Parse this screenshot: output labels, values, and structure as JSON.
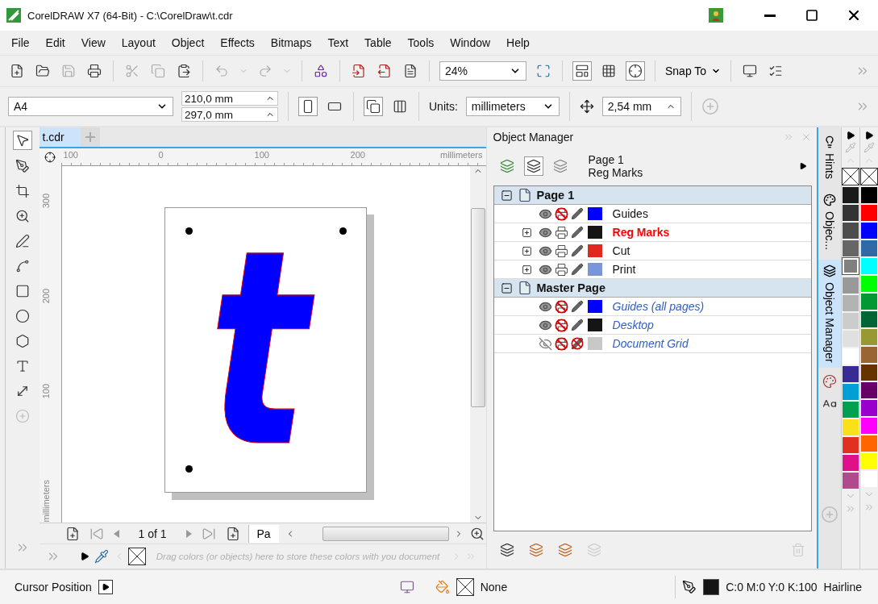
{
  "window": {
    "title": "CorelDRAW X7 (64-Bit) - C:\\CorelDraw\\t.cdr"
  },
  "menu": [
    {
      "label": "File"
    },
    {
      "label": "Edit"
    },
    {
      "label": "View"
    },
    {
      "label": "Layout"
    },
    {
      "label": "Object"
    },
    {
      "label": "Effects"
    },
    {
      "label": "Bitmaps"
    },
    {
      "label": "Text"
    },
    {
      "label": "Table"
    },
    {
      "label": "Tools"
    },
    {
      "label": "Window"
    },
    {
      "label": "Help"
    }
  ],
  "toolbar": {
    "zoom": "24%",
    "snap_to": "Snap To"
  },
  "property_bar": {
    "page_size": "A4",
    "width": "210,0 mm",
    "height": "297,0 mm",
    "units_label": "Units:",
    "units": "millimeters",
    "nudge": "2,54 mm"
  },
  "document_tabs": [
    {
      "label": "t.cdr",
      "selected": true
    }
  ],
  "rulers": {
    "horizontal_labels": [
      "100",
      "0",
      "100",
      "200"
    ],
    "horizontal_unit": "millimeters",
    "vertical_labels": [
      "300",
      "200",
      "100"
    ],
    "vertical_unit": "millimeters"
  },
  "canvas": {
    "artwork_text": "t"
  },
  "page_navigator": {
    "counter": "1 of 1",
    "page_tab": "Pa"
  },
  "color_tray": {
    "hint": "Drag colors (or objects) here to store these colors with you document"
  },
  "object_manager": {
    "title": "Object Manager",
    "breadcrumb": [
      "Page 1",
      "Reg Marks"
    ],
    "pages": [
      {
        "name": "Page 1",
        "expanded": true,
        "layers": [
          {
            "name": "Guides",
            "kind": "layer",
            "selected": false,
            "expandable": false,
            "visible": true,
            "printable": false,
            "editable": true,
            "color": "#0000ff"
          },
          {
            "name": "Reg Marks",
            "kind": "layer",
            "selected": true,
            "expandable": true,
            "visible": true,
            "printable": true,
            "editable": true,
            "color": "#151515"
          },
          {
            "name": "Cut",
            "kind": "layer",
            "selected": false,
            "expandable": true,
            "visible": true,
            "printable": true,
            "editable": true,
            "color": "#e0281e"
          },
          {
            "name": "Print",
            "kind": "layer",
            "selected": false,
            "expandable": true,
            "visible": true,
            "printable": true,
            "editable": true,
            "color": "#7a96d6"
          }
        ]
      },
      {
        "name": "Master Page",
        "expanded": true,
        "layers": [
          {
            "name": "Guides (all pages)",
            "kind": "master_layer",
            "selected": false,
            "expandable": false,
            "visible": true,
            "printable": false,
            "editable": true,
            "color": "#0000ff"
          },
          {
            "name": "Desktop",
            "kind": "master_layer",
            "selected": false,
            "expandable": false,
            "visible": true,
            "printable": false,
            "editable": true,
            "color": "#151515"
          },
          {
            "name": "Document Grid",
            "kind": "master_layer",
            "selected": false,
            "expandable": false,
            "visible": false,
            "printable": false,
            "editable": false,
            "color": "#c8c8c8"
          }
        ]
      }
    ]
  },
  "docker_tabs": [
    {
      "label": "Hints",
      "selected": false
    },
    {
      "label": "Objec...",
      "selected": false
    },
    {
      "label": "Object Manager",
      "selected": true
    }
  ],
  "palettes": [
    {
      "swatches": [
        {
          "color": "#1a1a1a",
          "selected": false
        },
        {
          "color": "#333333",
          "selected": false
        },
        {
          "color": "#4d4d4d",
          "selected": false
        },
        {
          "color": "#666666",
          "selected": false
        },
        {
          "color": "#808080",
          "selected": true
        },
        {
          "color": "#999999",
          "selected": false
        },
        {
          "color": "#b3b3b3",
          "selected": false
        },
        {
          "color": "#cccccc",
          "selected": false
        },
        {
          "color": "#e0e0e0",
          "selected": false
        },
        {
          "color": "#ffffff",
          "selected": false
        },
        {
          "color": "#3a2a94",
          "selected": false
        },
        {
          "color": "#00a0d6",
          "selected": false
        },
        {
          "color": "#00a050",
          "selected": false
        },
        {
          "color": "#f8e01a",
          "selected": false
        },
        {
          "color": "#e03020",
          "selected": false
        },
        {
          "color": "#e0108a",
          "selected": false
        },
        {
          "color": "#b04a8c",
          "selected": false
        }
      ]
    },
    {
      "swatches": [
        {
          "color": "#000000",
          "selected": false
        },
        {
          "color": "#ff0000",
          "selected": false
        },
        {
          "color": "#0000ff",
          "selected": false
        },
        {
          "color": "#2f6aa6",
          "selected": false
        },
        {
          "color": "#00ffff",
          "selected": false
        },
        {
          "color": "#00ff00",
          "selected": false
        },
        {
          "color": "#009933",
          "selected": false
        },
        {
          "color": "#006633",
          "selected": false
        },
        {
          "color": "#999933",
          "selected": false
        },
        {
          "color": "#996633",
          "selected": false
        },
        {
          "color": "#663300",
          "selected": false
        },
        {
          "color": "#660066",
          "selected": false
        },
        {
          "color": "#9900cc",
          "selected": false
        },
        {
          "color": "#ff00ff",
          "selected": false
        },
        {
          "color": "#ff6600",
          "selected": false
        },
        {
          "color": "#ffff00",
          "selected": false
        },
        {
          "color": "#ffffff",
          "selected": false
        }
      ]
    }
  ],
  "status_bar": {
    "cursor_position": "Cursor Position",
    "fill": "None",
    "outline_color": "C:0 M:0 Y:0 K:100",
    "outline_width": "Hairline"
  }
}
